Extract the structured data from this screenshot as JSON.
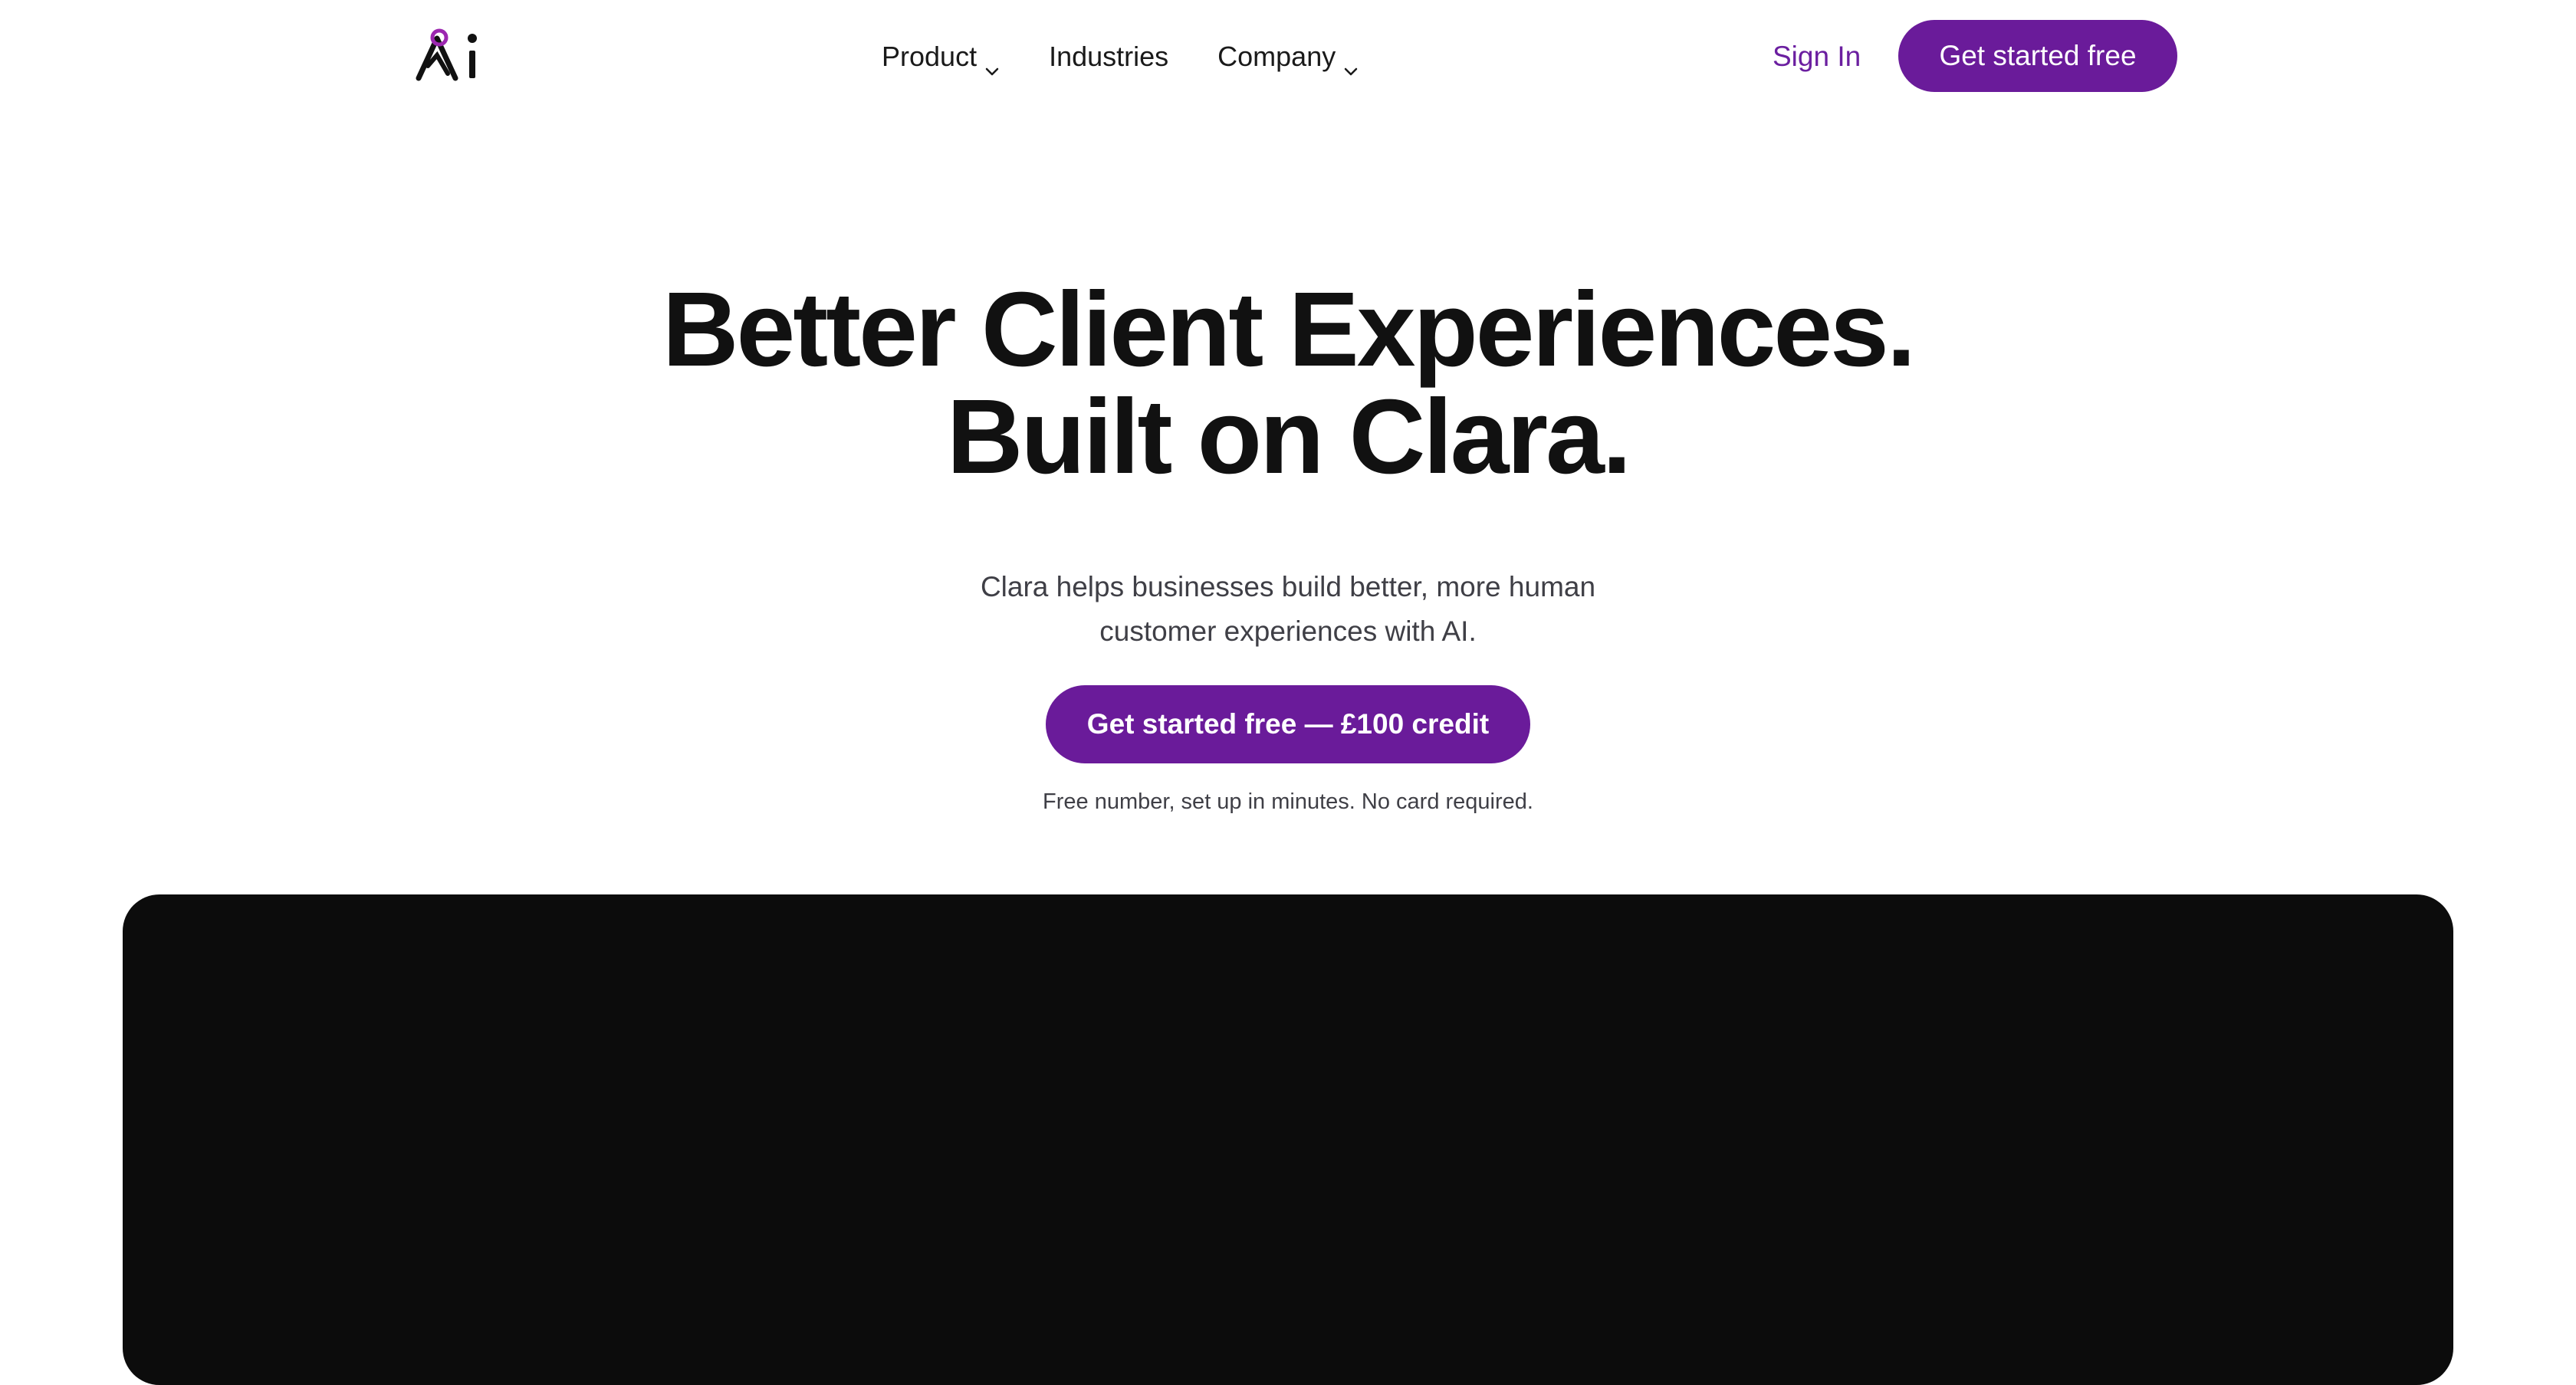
{
  "header": {
    "logo": {
      "icon": "ai-logo-icon",
      "text": "Ai",
      "accent": "#9c27b0"
    },
    "nav": [
      {
        "label": "Product",
        "has_dropdown": true
      },
      {
        "label": "Industries",
        "has_dropdown": false
      },
      {
        "label": "Company",
        "has_dropdown": true
      }
    ],
    "sign_in_label": "Sign In",
    "cta_label": "Get started free"
  },
  "hero": {
    "title_line1": "Better Client Experiences.",
    "title_line2": "Built on Clara.",
    "subtitle_line1": "Clara helps businesses build better, more human",
    "subtitle_line2": "customer experiences with AI.",
    "cta_label": "Get started free — £100 credit",
    "note": "Free number, set up in minutes. No card required."
  },
  "colors": {
    "brand": "#6a1b9a",
    "sign_in": "#6b1fa0",
    "text": "#111111",
    "muted": "#3f3f46",
    "media_bg": "#0c0c0c"
  }
}
